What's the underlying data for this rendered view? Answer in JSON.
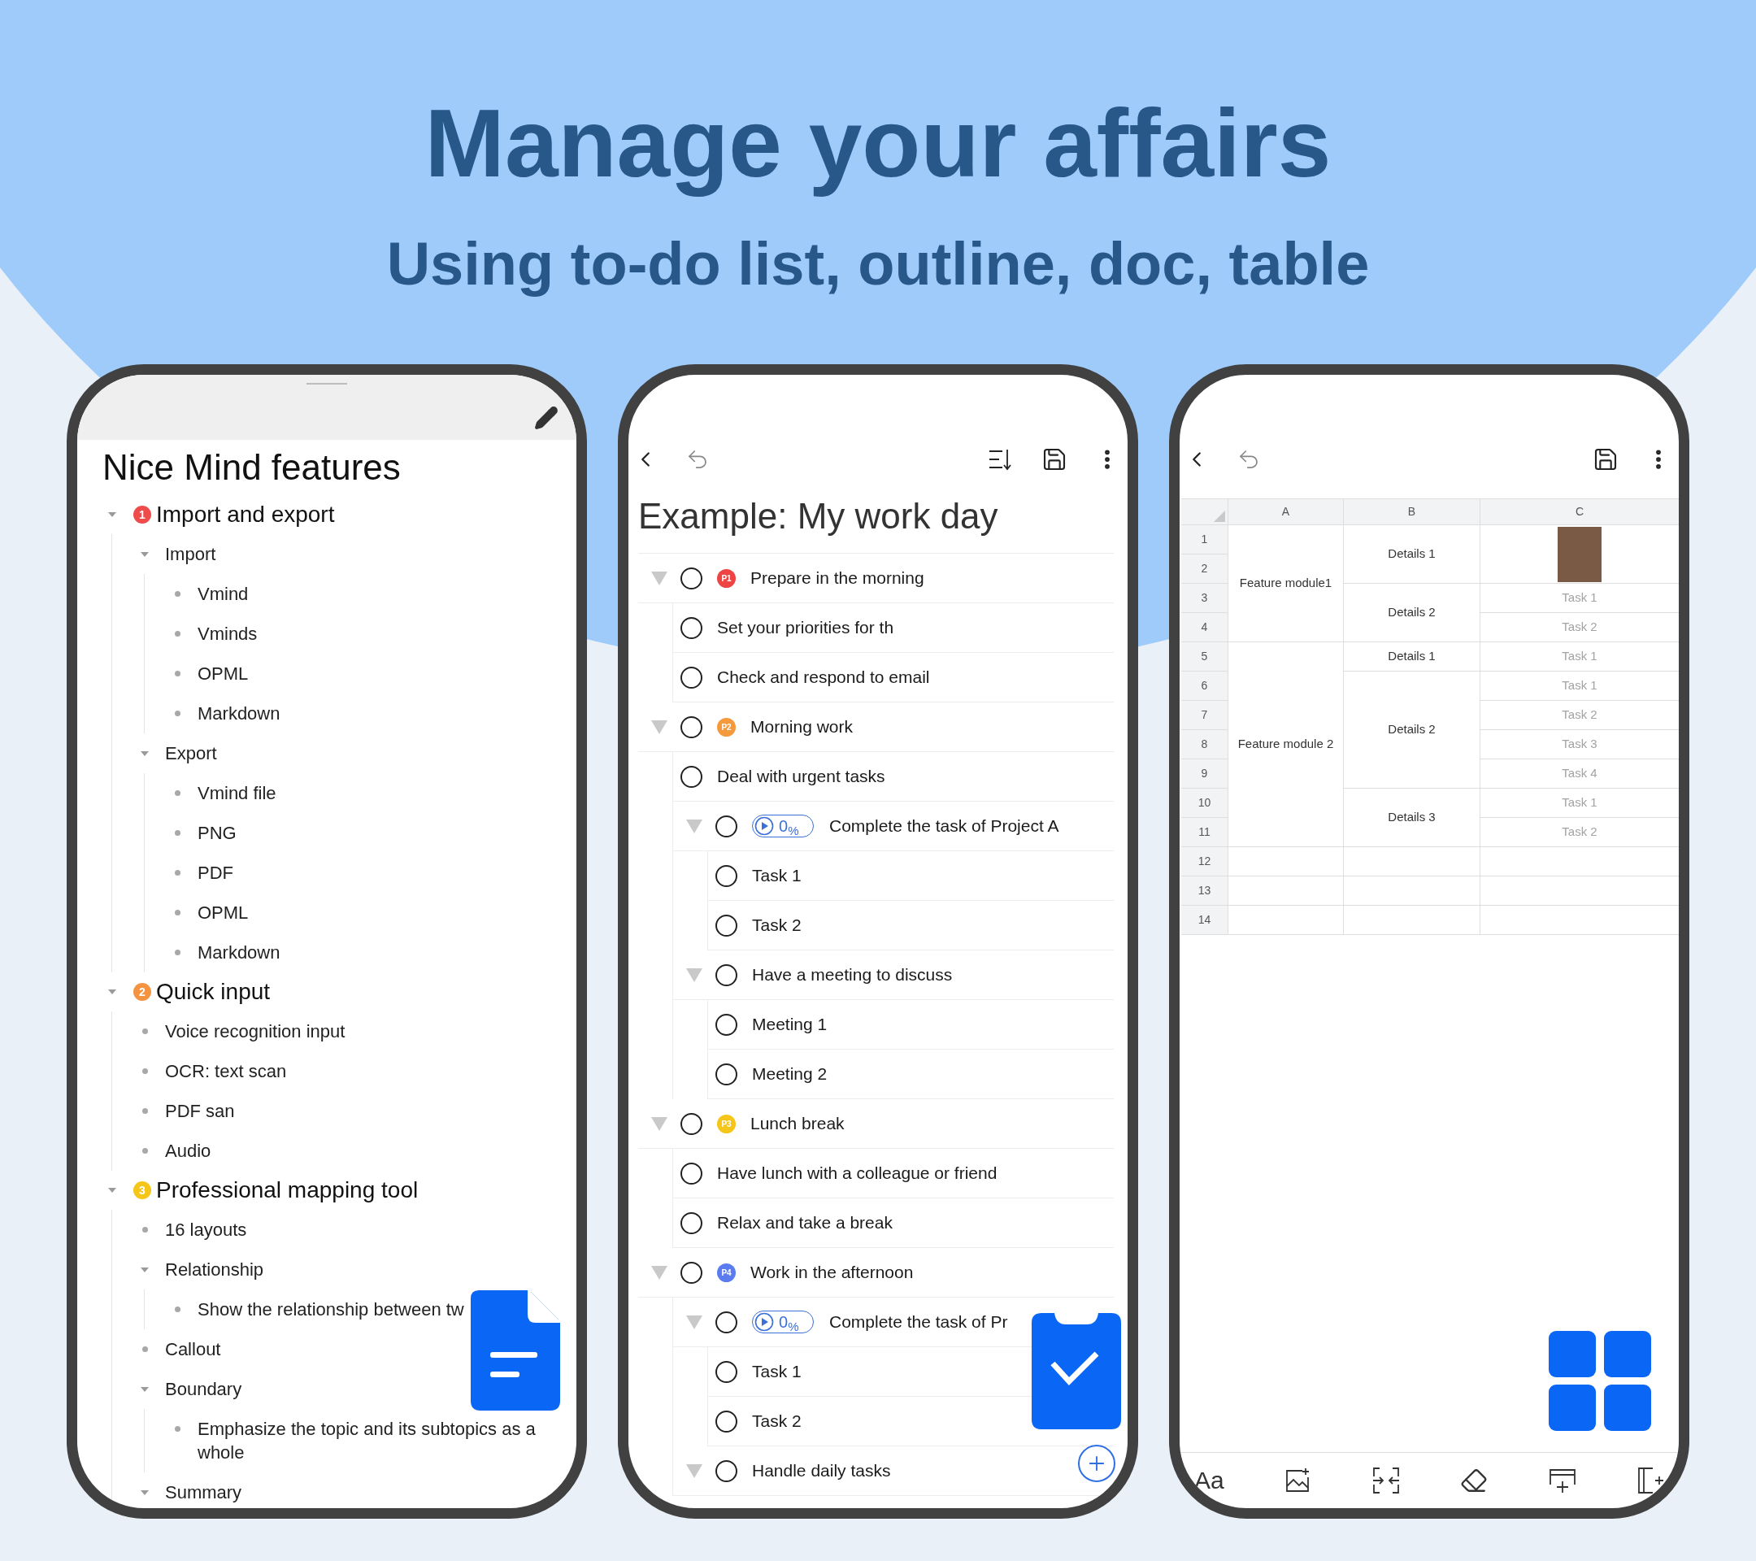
{
  "headline": "Manage your affairs",
  "subheadline": "Using to-do list, outline, doc, table",
  "outline": {
    "title": "Nice Mind features",
    "items": [
      {
        "kind": "heading",
        "number": "1",
        "color": "#ef4b4b",
        "text": "Import and export",
        "expanded": true,
        "children": [
          {
            "kind": "branch",
            "text": "Import",
            "expanded": true,
            "children": [
              {
                "kind": "leaf",
                "text": "Vmind"
              },
              {
                "kind": "leaf",
                "text": "Vminds"
              },
              {
                "kind": "leaf",
                "text": "OPML"
              },
              {
                "kind": "leaf",
                "text": "Markdown"
              }
            ]
          },
          {
            "kind": "branch",
            "text": "Export",
            "expanded": true,
            "children": [
              {
                "kind": "leaf",
                "text": "Vmind file"
              },
              {
                "kind": "leaf",
                "text": "PNG"
              },
              {
                "kind": "leaf",
                "text": "PDF"
              },
              {
                "kind": "leaf",
                "text": "OPML"
              },
              {
                "kind": "leaf",
                "text": "Markdown"
              }
            ]
          }
        ]
      },
      {
        "kind": "heading",
        "number": "2",
        "color": "#f59440",
        "text": "Quick input",
        "expanded": true,
        "children": [
          {
            "kind": "leaf",
            "text": "Voice recognition input"
          },
          {
            "kind": "leaf",
            "text": "OCR: text scan"
          },
          {
            "kind": "leaf",
            "text": "PDF san"
          },
          {
            "kind": "leaf",
            "text": "Audio"
          }
        ]
      },
      {
        "kind": "heading",
        "number": "3",
        "color": "#f5c518",
        "text": "Professional mapping tool",
        "expanded": true,
        "children": [
          {
            "kind": "leaf",
            "text": "16 layouts"
          },
          {
            "kind": "branch",
            "text": "Relationship",
            "expanded": true,
            "children": [
              {
                "kind": "leaf",
                "text": "Show the relationship between tw"
              }
            ]
          },
          {
            "kind": "leaf",
            "text": "Callout"
          },
          {
            "kind": "branch",
            "text": "Boundary",
            "expanded": true,
            "children": [
              {
                "kind": "leaf",
                "text": "Emphasize the topic and its subtopics as a whole"
              }
            ]
          },
          {
            "kind": "branch",
            "text": "Summary",
            "expanded": true
          }
        ]
      }
    ]
  },
  "todo": {
    "title": "Example: My work day",
    "tasks": [
      {
        "text": "Prepare in the morning",
        "checked": false,
        "expanded": true,
        "priority": "P1",
        "color": "#ee4444",
        "children": [
          {
            "text": "Set your priorities for th",
            "checked": false
          },
          {
            "text": "Check and respond to email",
            "checked": false
          }
        ]
      },
      {
        "text": "Morning work",
        "checked": false,
        "expanded": true,
        "priority": "P2",
        "color": "#f59a3c",
        "children": [
          {
            "text": "Deal with urgent tasks",
            "checked": false
          },
          {
            "text": "Complete the task of Project A",
            "checked": false,
            "expanded": true,
            "progress": "0$_{%}$",
            "children": [
              {
                "text": "Task 1",
                "checked": false
              },
              {
                "text": "Task 2",
                "checked": false
              }
            ]
          },
          {
            "text": "Have a meeting to discuss",
            "checked": false,
            "expanded": true,
            "children": [
              {
                "text": "Meeting 1",
                "checked": false
              },
              {
                "text": "Meeting 2",
                "checked": false
              }
            ]
          }
        ]
      },
      {
        "text": "Lunch break",
        "checked": false,
        "expanded": true,
        "priority": "P3",
        "color": "#f5c51a",
        "children": [
          {
            "text": "Have lunch with a colleague or friend",
            "checked": false
          },
          {
            "text": "Relax and take a break",
            "checked": false
          }
        ]
      },
      {
        "text": "Work in the afternoon",
        "checked": false,
        "expanded": true,
        "priority": "P4",
        "color": "#5b7cf0",
        "children": [
          {
            "text": "Complete the task of Pr",
            "checked": false,
            "expanded": true,
            "progress": "0$_{%}$",
            "children": [
              {
                "text": "Task 1",
                "checked": false
              },
              {
                "text": "Task 2",
                "checked": false
              }
            ]
          },
          {
            "text": "Handle daily tasks",
            "checked": false,
            "expanded": true
          }
        ]
      }
    ]
  },
  "sheet": {
    "columns": [
      "A",
      "B",
      "C"
    ],
    "row_numbers": [
      "1",
      "2",
      "3",
      "4",
      "5",
      "6",
      "7",
      "8",
      "9",
      "10",
      "11",
      "12",
      "13",
      "14"
    ],
    "column_a": [
      "Feature module1",
      "Feature module 2"
    ],
    "column_b": [
      "Details 1",
      "Details 2",
      "Details 1",
      "Details 2",
      "Details 3"
    ],
    "column_c": [
      {
        "kind": "photo"
      },
      {
        "kind": "text",
        "text": "Task 1"
      },
      {
        "kind": "text",
        "text": "Task 2"
      },
      {
        "kind": "text",
        "text": "Task 1"
      },
      {
        "kind": "text",
        "text": "Task 1"
      },
      {
        "kind": "text",
        "text": "Task 2"
      },
      {
        "kind": "text",
        "text": "Task 3"
      },
      {
        "kind": "text",
        "text": "Task 4"
      },
      {
        "kind": "text",
        "text": "Task 1"
      },
      {
        "kind": "text",
        "text": "Task 2"
      }
    ],
    "format_label": "Aa"
  }
}
